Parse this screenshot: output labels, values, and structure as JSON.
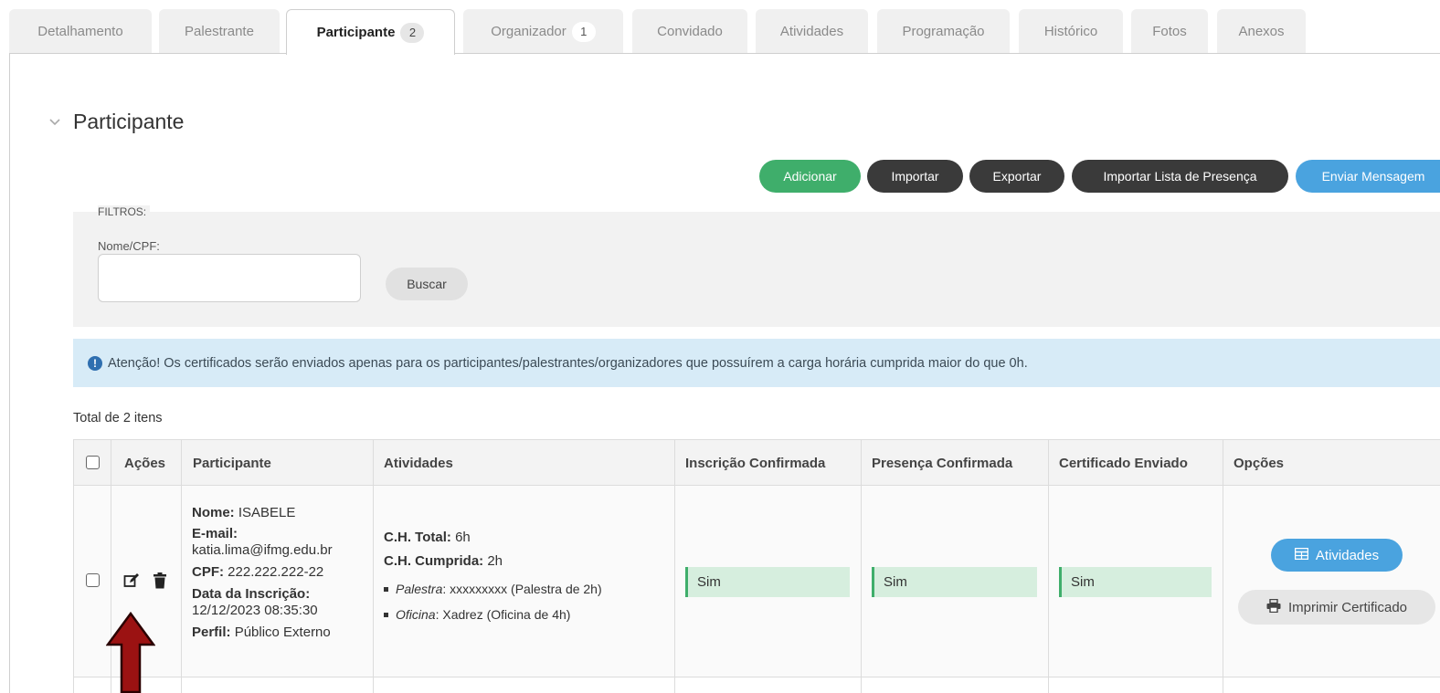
{
  "tabs": [
    {
      "label": "Detalhamento"
    },
    {
      "label": "Palestrante"
    },
    {
      "label": "Participante",
      "count": "2"
    },
    {
      "label": "Organizador",
      "count": "1"
    },
    {
      "label": "Convidado"
    },
    {
      "label": "Atividades"
    },
    {
      "label": "Programação"
    },
    {
      "label": "Histórico"
    },
    {
      "label": "Fotos"
    },
    {
      "label": "Anexos"
    }
  ],
  "section": {
    "title": "Participante"
  },
  "toolbar": {
    "add": "Adicionar",
    "import": "Importar",
    "export": "Exportar",
    "import_attendance": "Importar Lista de Presença",
    "send_message": "Enviar Mensagem"
  },
  "filters": {
    "legend": "FILTROS:",
    "name_label": "Nome/CPF:",
    "name_value": "",
    "search": "Buscar"
  },
  "alert": {
    "icon": "info-icon",
    "text": "Atenção! Os certificados serão enviados apenas para os participantes/palestrantes/organizadores que possuírem a carga horária cumprida maior do que 0h."
  },
  "total": "Total de 2 itens",
  "table": {
    "headers": [
      "Ações",
      "Participante",
      "Atividades",
      "Inscrição Confirmada",
      "Presença Confirmada",
      "Certificado Enviado",
      "Opções"
    ],
    "row": {
      "nome_label": "Nome:",
      "nome": "ISABELE",
      "email_label": "E-mail:",
      "email": "katia.lima@ifmg.edu.br",
      "cpf_label": "CPF:",
      "cpf": "222.222.222-22",
      "data_label": "Data da Inscrição:",
      "data": "12/12/2023 08:35:30",
      "perfil_label": "Perfil:",
      "perfil": "Público Externo",
      "ch_total_label": "C.H. Total:",
      "ch_total": "6h",
      "ch_cumprida_label": "C.H. Cumprida:",
      "ch_cumprida": "2h",
      "activity1_type": "Palestra",
      "activity1": ": xxxxxxxxx (Palestra de 2h)",
      "activity2_type": "Oficina",
      "activity2": ": Xadrez (Oficina de 4h)",
      "inscricao": "Sim",
      "presenca": "Sim",
      "certificado": "Sim",
      "btn_atividades": "Atividades",
      "btn_imprimir": "Imprimir Certificado"
    }
  },
  "colors": {
    "green": "#3fae6b",
    "dark": "#3a3a3a",
    "blue": "#4aa3df",
    "arrow": "#9b1212"
  }
}
